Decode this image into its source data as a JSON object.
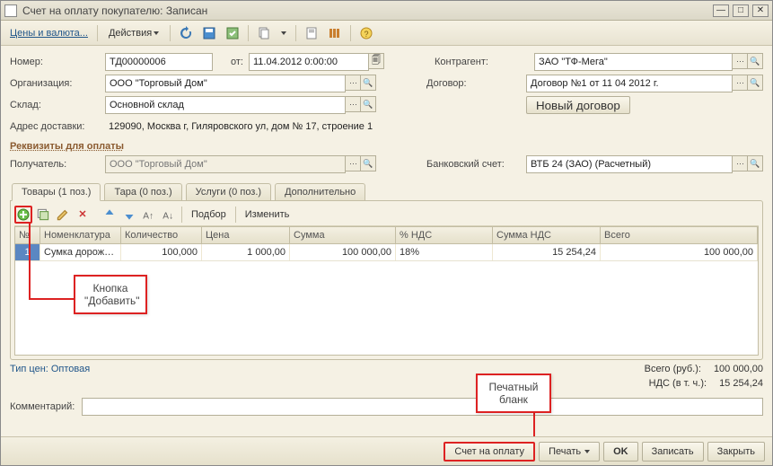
{
  "window": {
    "title": "Счет на оплату покупателю: Записан"
  },
  "toolbar": {
    "prices": "Цены и валюта...",
    "actions": "Действия"
  },
  "fields": {
    "number_label": "Номер:",
    "number": "ТД00000006",
    "from_label": "от:",
    "date": "11.04.2012 0:00:00",
    "org_label": "Организация:",
    "org": "ООО \"Торговый Дом\"",
    "warehouse_label": "Склад:",
    "warehouse": "Основной склад",
    "addr_label": "Адрес доставки:",
    "addr": "129090, Москва г, Гиляровского ул, дом № 17, строение 1",
    "contragent_label": "Контрагент:",
    "contragent": "ЗАО \"ТФ-Мега\"",
    "contract_label": "Договор:",
    "contract": "Договор №1 от 11 04 2012 г.",
    "new_contract": "Новый договор",
    "requisites_hdr": "Реквизиты для оплаты",
    "recipient_label": "Получатель:",
    "recipient": "ООО \"Торговый Дом\"",
    "bank_label": "Банковский счет:",
    "bank": "ВТБ 24 (ЗАО) (Расчетный)"
  },
  "tabs": {
    "goods": "Товары (1 поз.)",
    "tare": "Тара (0 поз.)",
    "services": "Услуги (0 поз.)",
    "extra": "Дополнительно"
  },
  "grid_toolbar": {
    "select": "Подбор",
    "edit": "Изменить"
  },
  "grid": {
    "h_n": "№",
    "h_nom": "Номенклатура",
    "h_qty": "Количество",
    "h_price": "Цена",
    "h_sum": "Сумма",
    "h_nds": "% НДС",
    "h_snds": "Сумма НДС",
    "h_total": "Всего",
    "rows": [
      {
        "n": "1",
        "nom": "Сумка дорожн...",
        "qty": "100,000",
        "price": "1 000,00",
        "sum": "100 000,00",
        "nds": "18%",
        "snds": "15 254,24",
        "total": "100 000,00"
      }
    ]
  },
  "callouts": {
    "add_l1": "Кнопка",
    "add_l2": "\"Добавить\"",
    "print_l1": "Печатный",
    "print_l2": "бланк"
  },
  "bottom": {
    "price_type": "Тип цен: Оптовая",
    "total_label": "Всего (руб.):",
    "total": "100 000,00",
    "nds_label": "НДС (в т. ч.):",
    "nds": "15 254,24",
    "comment_label": "Комментарий:"
  },
  "footer": {
    "invoice": "Счет на оплату",
    "print": "Печать",
    "ok": "OK",
    "save": "Записать",
    "close": "Закрыть"
  }
}
